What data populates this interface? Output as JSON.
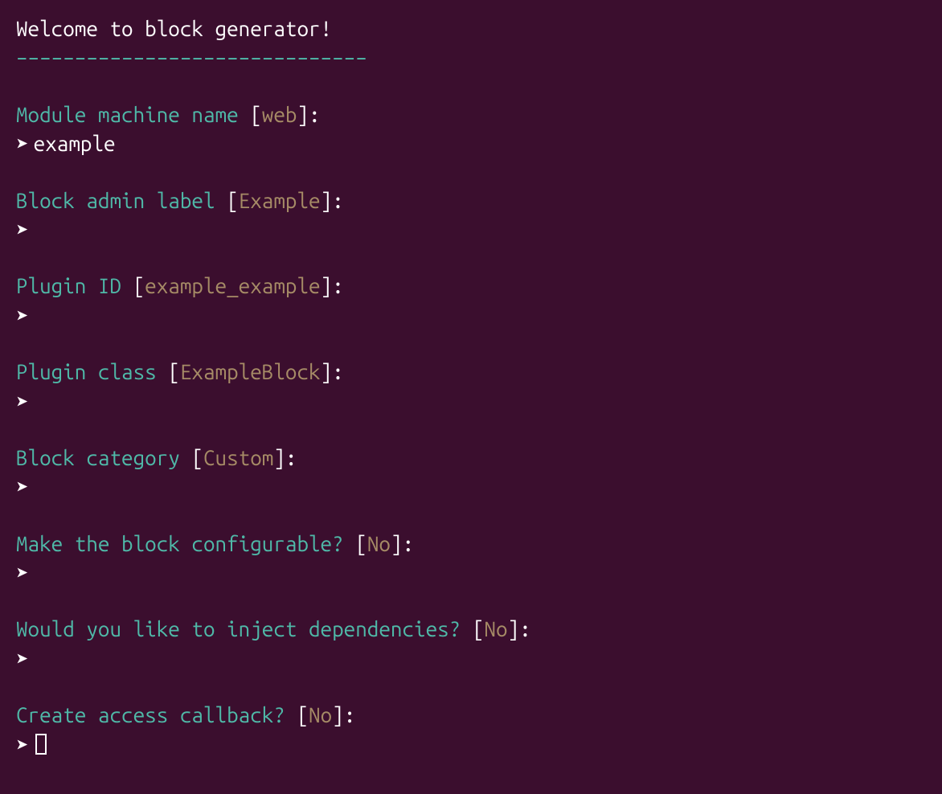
{
  "header": {
    "title": " Welcome to block generator!",
    "underline": "––––––––––––––––––––––––––––––"
  },
  "prompts": [
    {
      "question": " Module machine name",
      "default": "web",
      "answer": "example"
    },
    {
      "question": " Block admin label",
      "default": "Example",
      "answer": ""
    },
    {
      "question": " Plugin ID",
      "default": "example_example",
      "answer": ""
    },
    {
      "question": " Plugin class",
      "default": "ExampleBlock",
      "answer": ""
    },
    {
      "question": " Block category",
      "default": "Custom",
      "answer": ""
    },
    {
      "question": " Make the block configurable?",
      "default": "No",
      "answer": ""
    },
    {
      "question": " Would you like to inject dependencies?",
      "default": "No",
      "answer": ""
    },
    {
      "question": " Create access callback?",
      "default": "No",
      "answer": "",
      "cursor": true
    }
  ]
}
